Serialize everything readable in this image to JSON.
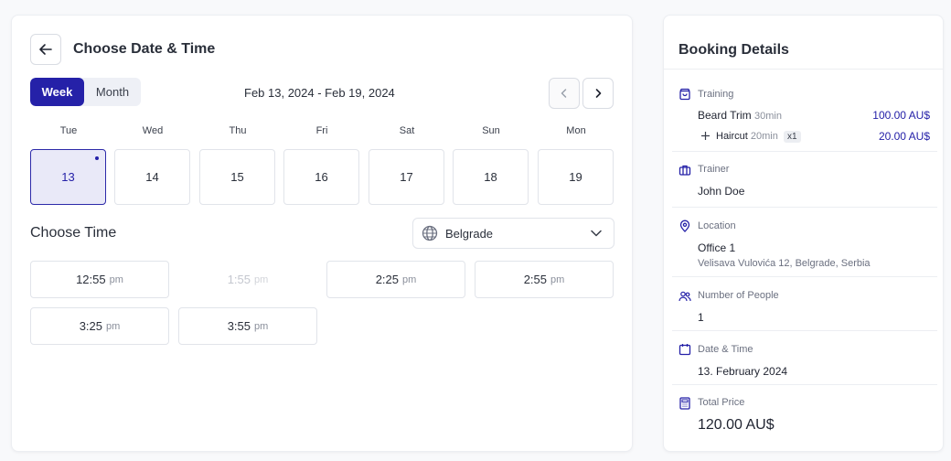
{
  "booking": {
    "title": "Choose Date & Time",
    "view_toggle": {
      "week": "Week",
      "month": "Month"
    },
    "date_range": "Feb 13, 2024 - Feb 19, 2024",
    "days": [
      {
        "weekday": "Tue",
        "date": "13",
        "selected": true
      },
      {
        "weekday": "Wed",
        "date": "14"
      },
      {
        "weekday": "Thu",
        "date": "15"
      },
      {
        "weekday": "Fri",
        "date": "16"
      },
      {
        "weekday": "Sat",
        "date": "17"
      },
      {
        "weekday": "Sun",
        "date": "18"
      },
      {
        "weekday": "Mon",
        "date": "19"
      }
    ],
    "choose_time_label": "Choose Time",
    "timezone": "Belgrade",
    "slots": [
      {
        "time": "12:55",
        "ampm": "pm"
      },
      {
        "time": "1:55",
        "ampm": "pm",
        "disabled": true
      },
      {
        "time": "2:25",
        "ampm": "pm"
      },
      {
        "time": "2:55",
        "ampm": "pm"
      },
      {
        "time": "3:25",
        "ampm": "pm"
      },
      {
        "time": "3:55",
        "ampm": "pm"
      }
    ]
  },
  "details": {
    "title": "Booking Details",
    "training": {
      "label": "Training",
      "service": "Beard Trim",
      "service_duration": "30min",
      "service_price": "100.00 AU$",
      "extra": "Haircut",
      "extra_duration": "20min",
      "extra_qty": "x1",
      "extra_price": "20.00 AU$"
    },
    "trainer": {
      "label": "Trainer",
      "value": "John Doe"
    },
    "location": {
      "label": "Location",
      "value": "Office 1",
      "address": "Velisava Vulovića 12, Belgrade, Serbia"
    },
    "people": {
      "label": "Number of People",
      "value": "1"
    },
    "datetime": {
      "label": "Date & Time",
      "value": "13. February 2024"
    },
    "total": {
      "label": "Total Price",
      "value": "120.00 AU$"
    }
  },
  "colors": {
    "accent": "#2521a8",
    "selected_bg": "#e9e9f8"
  }
}
